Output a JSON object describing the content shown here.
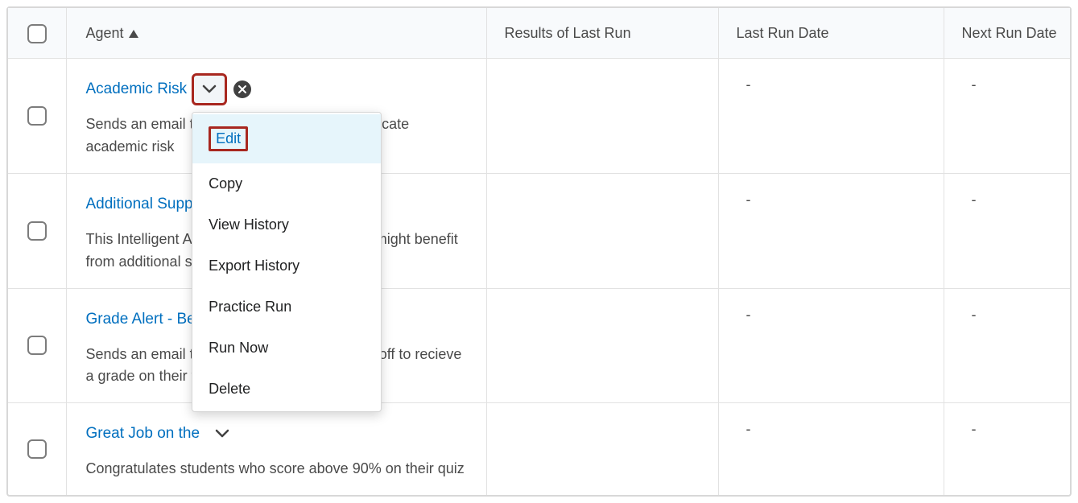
{
  "columns": {
    "agent": "Agent",
    "results": "Results of Last Run",
    "lastRun": "Last Run Date",
    "nextRun": "Next Run Date"
  },
  "rows": [
    {
      "name": "Academic Risk",
      "desc": "Sends an email to the student's Advisor to indicate academic risk",
      "results": "",
      "lastRun": "-",
      "nextRun": "-",
      "disabled": true,
      "showMenu": true
    },
    {
      "name": "Additional Support",
      "desc": "This Intelligent Agent identifies students who might benefit from additional support",
      "results": "",
      "lastRun": "-",
      "nextRun": "-",
      "disabled": false,
      "showMenu": false
    },
    {
      "name": "Grade Alert - Below 80%",
      "desc": "Sends an email to students who have started off to recieve a grade on their first quiz that is below 80%",
      "results": "",
      "lastRun": "-",
      "nextRun": "-",
      "disabled": false,
      "showMenu": false
    },
    {
      "name": "Great Job on the",
      "desc": "Congratulates students who score above 90% on their quiz",
      "results": "",
      "lastRun": "-",
      "nextRun": "-",
      "disabled": false,
      "showMenu": false
    }
  ],
  "menu": {
    "edit": "Edit",
    "copy": "Copy",
    "viewHistory": "View History",
    "exportHistory": "Export History",
    "practiceRun": "Practice Run",
    "runNow": "Run Now",
    "delete": "Delete"
  }
}
